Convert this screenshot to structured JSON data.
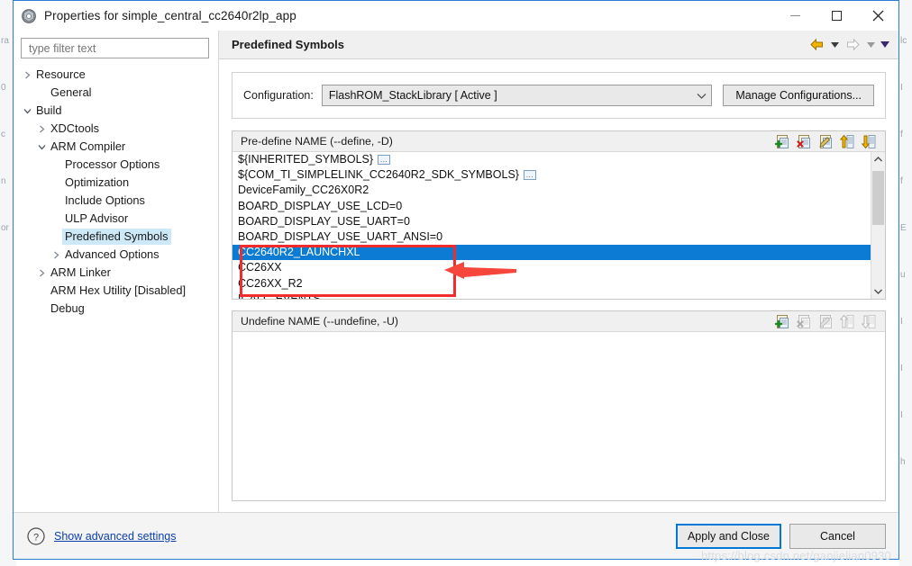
{
  "window": {
    "title": "Properties for simple_central_cc2640r2lp_app",
    "icon": "eclipse-properties-icon",
    "buttons": {
      "minimize": "minimize-button",
      "maximize": "maximize-button",
      "close": "close-button"
    }
  },
  "sidebar": {
    "filter": {
      "placeholder": "type filter text",
      "value": ""
    },
    "items": [
      {
        "label": "Resource",
        "indent": 0,
        "twisty": "collapsed",
        "selected": false
      },
      {
        "label": "General",
        "indent": 1,
        "twisty": "none",
        "selected": false
      },
      {
        "label": "Build",
        "indent": 0,
        "twisty": "expanded",
        "selected": false
      },
      {
        "label": "XDCtools",
        "indent": 1,
        "twisty": "collapsed",
        "selected": false
      },
      {
        "label": "ARM Compiler",
        "indent": 1,
        "twisty": "expanded",
        "selected": false
      },
      {
        "label": "Processor Options",
        "indent": 2,
        "twisty": "none",
        "selected": false
      },
      {
        "label": "Optimization",
        "indent": 2,
        "twisty": "none",
        "selected": false
      },
      {
        "label": "Include Options",
        "indent": 2,
        "twisty": "none",
        "selected": false
      },
      {
        "label": "ULP Advisor",
        "indent": 2,
        "twisty": "none",
        "selected": false
      },
      {
        "label": "Predefined Symbols",
        "indent": 2,
        "twisty": "none",
        "selected": true
      },
      {
        "label": "Advanced Options",
        "indent": 2,
        "twisty": "collapsed",
        "selected": false
      },
      {
        "label": "ARM Linker",
        "indent": 1,
        "twisty": "collapsed",
        "selected": false
      },
      {
        "label": "ARM Hex Utility  [Disabled]",
        "indent": 1,
        "twisty": "none",
        "selected": false
      },
      {
        "label": "Debug",
        "indent": 1,
        "twisty": "none",
        "selected": false
      }
    ]
  },
  "page": {
    "title": "Predefined Symbols",
    "nav": {
      "back": "back-arrow-icon",
      "back_menu": "back-dropdown-icon",
      "forward": "forward-arrow-icon",
      "forward_menu": "forward-dropdown-icon",
      "view_menu": "view-menu-icon"
    },
    "configuration": {
      "label": "Configuration:",
      "value": "FlashROM_StackLibrary  [ Active ]",
      "manage_button": "Manage Configurations..."
    },
    "predefine": {
      "header": "Pre-define NAME (--define, -D)",
      "tools": [
        {
          "name": "add-symbol-button",
          "enabled": true
        },
        {
          "name": "delete-symbol-button",
          "enabled": true
        },
        {
          "name": "edit-symbol-button",
          "enabled": true
        },
        {
          "name": "move-up-button",
          "enabled": true
        },
        {
          "name": "move-down-button",
          "enabled": true
        }
      ],
      "rows": [
        {
          "text": "${INHERITED_SYMBOLS}",
          "badge": "...",
          "selected": false
        },
        {
          "text": "${COM_TI_SIMPLELINK_CC2640R2_SDK_SYMBOLS}",
          "badge": "...",
          "selected": false
        },
        {
          "text": "DeviceFamily_CC26X0R2",
          "badge": "",
          "selected": false
        },
        {
          "text": "BOARD_DISPLAY_USE_LCD=0",
          "badge": "",
          "selected": false
        },
        {
          "text": "BOARD_DISPLAY_USE_UART=0",
          "badge": "",
          "selected": false
        },
        {
          "text": "BOARD_DISPLAY_USE_UART_ANSI=0",
          "badge": "",
          "selected": false
        },
        {
          "text": "CC2640R2_LAUNCHXL",
          "badge": "",
          "selected": true
        },
        {
          "text": "CC26XX",
          "badge": "",
          "selected": false
        },
        {
          "text": "CC26XX_R2",
          "badge": "",
          "selected": false
        },
        {
          "text": "ICALL_EVENTS",
          "badge": "",
          "selected": false
        }
      ],
      "scrollbar": {
        "up": "scroll-up-icon",
        "down": "scroll-down-icon",
        "thumb_top_pct": 4,
        "thumb_height_pct": 46
      }
    },
    "undefine": {
      "header": "Undefine NAME (--undefine, -U)",
      "tools": [
        {
          "name": "add-undefine-button",
          "enabled": true
        },
        {
          "name": "delete-undefine-button",
          "enabled": false
        },
        {
          "name": "edit-undefine-button",
          "enabled": false
        },
        {
          "name": "move-up-undefine-button",
          "enabled": false
        },
        {
          "name": "move-down-undefine-button",
          "enabled": false
        }
      ],
      "rows": []
    }
  },
  "footer": {
    "help_icon": "help-question-icon",
    "advanced_link": "Show advanced settings",
    "apply_button": "Apply and Close",
    "cancel_button": "Cancel"
  },
  "watermark": "https://blog.csdn.net/ganjielian0930",
  "colors": {
    "selection_blue": "#0b7bd4",
    "tree_selection": "#cde8f7",
    "annotation_red": "#f22c2c",
    "link_blue": "#0b3fa8",
    "focus_border": "#0078d7"
  },
  "background_fragments": {
    "left": [
      "ra",
      "0",
      "c",
      "n",
      "or"
    ],
    "right": [
      "lc",
      "I",
      "f",
      "f",
      "E",
      "u",
      "I",
      "I",
      "I",
      "h"
    ]
  }
}
